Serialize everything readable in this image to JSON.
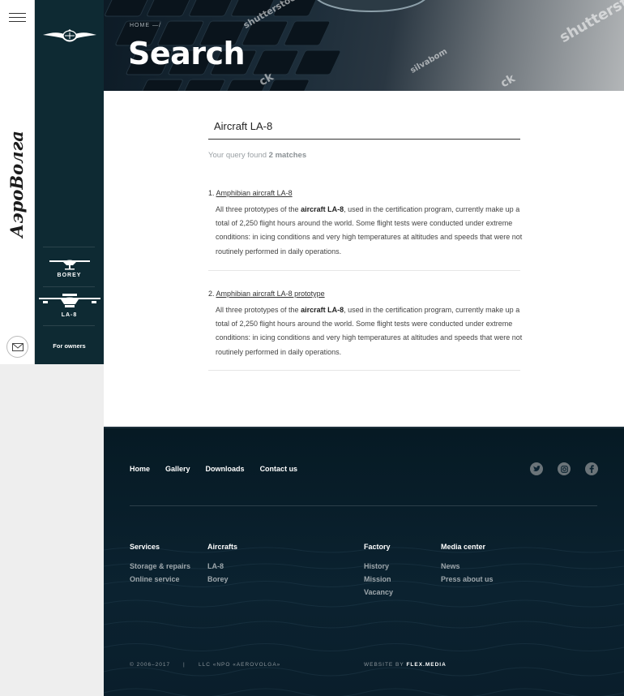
{
  "sidebar": {
    "brand_alt": "АэроВолга",
    "models": [
      {
        "label": "BOREY"
      },
      {
        "label": "LA-8"
      }
    ],
    "owners_label": "For owners"
  },
  "hero": {
    "breadcrumb": "HOME",
    "title": "Search",
    "watermarks": [
      "shutterstock",
      "silvabom",
      "shutterst",
      "silvabom",
      "ck",
      "ck"
    ]
  },
  "search": {
    "query": "Aircraft LA-8",
    "found_prefix": "Your query found",
    "found_count": "2 matches"
  },
  "results": [
    {
      "num": "1.",
      "title_a": "Amphibian",
      "title_b": "aircraft LA-8",
      "body_a": "All three prototypes of the",
      "body_bold": "aircraft LA-8",
      "body_b": ", used in the certification program, currently make up a total of 2,250 flight hours around the world. Some flight tests were conducted under extreme conditions: in icing conditions and very high temperatures at altitudes and speeds that were not routinely performed in daily operations."
    },
    {
      "num": "2.",
      "title_a": "Amphibian",
      "title_b": "aircraft LA-8 prototype",
      "body_a": "All three prototypes of the",
      "body_bold": "aircraft LA-8",
      "body_b": ", used in the certification program, currently make up a total of 2,250 flight hours around the world. Some flight tests were conducted under extreme conditions: in icing conditions and very high temperatures at altitudes and speeds that were not routinely performed in daily operations."
    }
  ],
  "footer": {
    "nav": [
      "Home",
      "Gallery",
      "Downloads",
      "Contact us"
    ],
    "social": [
      "twitter-icon",
      "instagram-icon",
      "facebook-icon"
    ],
    "columns": [
      {
        "title": "Services",
        "links": [
          "Storage & repairs",
          "Online service"
        ]
      },
      {
        "title": "Aircrafts",
        "links": [
          "LA-8",
          "Borey"
        ]
      },
      {
        "title": "Factory",
        "links": [
          "History",
          "Mission",
          "Vacancy"
        ]
      },
      {
        "title": "Media center",
        "links": [
          "News",
          "Press about us"
        ]
      }
    ],
    "copyright": "© 2006–2017",
    "separator": "|",
    "company": "LLC «NPO «AEROVOLGA»",
    "website_prefix": "WEBSITE BY",
    "website_name": "FLEX.MEDIA"
  },
  "colors": {
    "sidebar_bg": "#0e2a33",
    "footer_bg": "#0b2230",
    "accent_text": "#ffffff"
  }
}
